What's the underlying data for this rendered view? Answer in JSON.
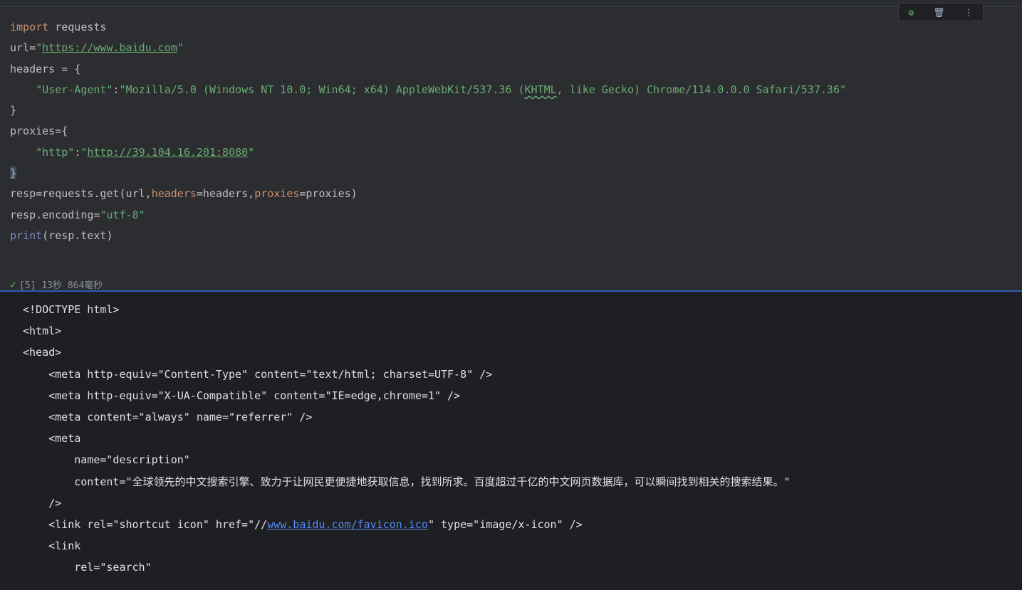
{
  "toolbar": {
    "icons": [
      "bug-icon",
      "trash-icon",
      "more-icon"
    ],
    "bug_glyph": "⚙",
    "trash_glyph": "🗑",
    "more_glyph": "⋮"
  },
  "code": {
    "l1_kw": "import",
    "l1_rest": " requests",
    "l2_a": "url=",
    "l2_q1": "\"",
    "l2_url": "https://www.baidu.com",
    "l2_q2": "\"",
    "l3": "headers = {",
    "l4_a": "    \"User-Agent\"",
    "l4_b": ":",
    "l4_c": "\"Mozilla/5.0 (Windows NT 10.0; Win64; x64) AppleWebKit/537.36 (",
    "l4_d": "KHTML",
    "l4_e": ", like Gecko) Chrome/114.0.0.0 Safari/537.36\"",
    "l5": "}",
    "l6": "proxies={",
    "l7_a": "    \"http\"",
    "l7_b": ":",
    "l7_q1": "\"",
    "l7_url": "http://39.104.16.201:8080",
    "l7_q2": "\"",
    "l8": "}",
    "l9_a": "resp=requests.get(url,",
    "l9_p1": "headers",
    "l9_b": "=headers,",
    "l9_p2": "proxies",
    "l9_c": "=proxies)",
    "l10_a": "resp.encoding=",
    "l10_b": "\"utf-8\"",
    "l11_a": "print",
    "l11_b": "(resp.text)"
  },
  "status": {
    "check": "✓",
    "text": "[5] 13秒 864毫秒"
  },
  "output": {
    "o1": "<!DOCTYPE html>",
    "o2": "<html>",
    "o3": "<head>",
    "o4": "    <meta http-equiv=\"Content-Type\" content=\"text/html; charset=UTF-8\" />",
    "o5": "    <meta http-equiv=\"X-UA-Compatible\" content=\"IE=edge,chrome=1\" />",
    "o6": "    <meta content=\"always\" name=\"referrer\" />",
    "o7": "    <meta",
    "o8": "        name=\"description\"",
    "o9_a": "        content=\"",
    "o9_b": "全球领先的中文搜索引擎、致力于让网民更便捷地获取信息，找到所求。百度超过千亿的中文网页数据库，可以瞬间找到相关的搜索结果。",
    "o9_c": "\"",
    "o10": "    />",
    "o11_a": "    <link rel=\"shortcut icon\" href=\"//",
    "o11_link": "www.baidu.com/favicon.ico",
    "o11_b": "\" type=\"image/x-icon\" />",
    "o12": "    <link",
    "o13": "        rel=\"search\""
  }
}
